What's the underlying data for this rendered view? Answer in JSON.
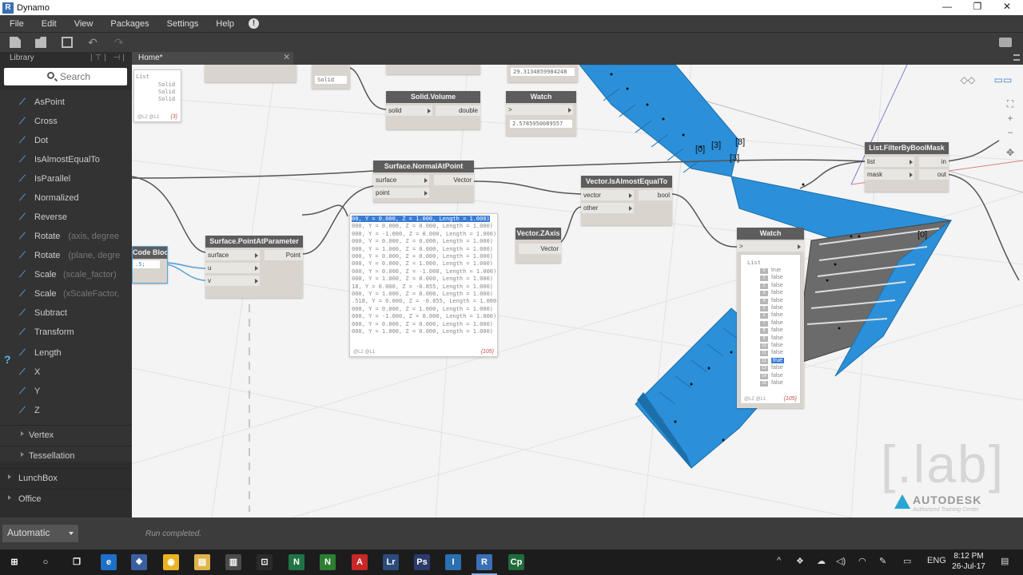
{
  "window": {
    "title": "Dynamo",
    "app_icon": "R",
    "minimize": "—",
    "maximize": "❐",
    "close": "✕"
  },
  "menu": {
    "items": [
      "File",
      "Edit",
      "View",
      "Packages",
      "Settings",
      "Help"
    ],
    "notice": "!"
  },
  "library": {
    "title": "Library",
    "search_placeholder": "Search",
    "items": [
      {
        "icon": "point-icon",
        "label": "AsPoint",
        "hint": ""
      },
      {
        "icon": "cross-icon",
        "label": "Cross",
        "hint": ""
      },
      {
        "icon": "dot-icon",
        "label": "Dot",
        "hint": ""
      },
      {
        "icon": "compare-icon",
        "label": "IsAlmostEqualTo",
        "hint": ""
      },
      {
        "icon": "parallel-icon",
        "label": "IsParallel",
        "hint": ""
      },
      {
        "icon": "normalize-icon",
        "label": "Normalized",
        "hint": ""
      },
      {
        "icon": "reverse-icon",
        "label": "Reverse",
        "hint": ""
      },
      {
        "icon": "rotate-icon",
        "label": "Rotate",
        "hint": "(axis, degree"
      },
      {
        "icon": "rotate-icon",
        "label": "Rotate",
        "hint": "(plane, degre"
      },
      {
        "icon": "scale-icon",
        "label": "Scale",
        "hint": "(scale_factor)"
      },
      {
        "icon": "scale-icon",
        "label": "Scale",
        "hint": "(xScaleFactor,"
      },
      {
        "icon": "subtract-icon",
        "label": "Subtract",
        "hint": ""
      },
      {
        "icon": "transform-icon",
        "label": "Transform",
        "hint": ""
      },
      {
        "icon": "length-icon",
        "label": "Length",
        "hint": ""
      },
      {
        "icon": "x-icon",
        "label": "X",
        "hint": ""
      },
      {
        "icon": "y-icon",
        "label": "Y",
        "hint": ""
      },
      {
        "icon": "z-icon",
        "label": "Z",
        "hint": ""
      }
    ],
    "help": "?",
    "categories": [
      "Vertex",
      "Tessellation",
      "LunchBox",
      "Office"
    ]
  },
  "tab": {
    "label": "Home*",
    "close": "✕"
  },
  "run": {
    "mode": "Automatic",
    "status": "Run completed."
  },
  "nodes": {
    "solid_volume": {
      "title": "Solid.Volume",
      "in": "solid",
      "out": "double"
    },
    "watch_top": {
      "title": "Watch",
      "value": "2.5785950089557"
    },
    "normal_at_point": {
      "title": "Surface.NormalAtPoint",
      "in1": "surface",
      "in2": "point",
      "out": "Vector"
    },
    "is_almost_equal": {
      "title": "Vector.IsAlmostEqualTo",
      "in1": "vector",
      "in2": "other",
      "out": "bool"
    },
    "filter_by_bool": {
      "title": "List.FilterByBoolMask",
      "in1": "list",
      "in2": "mask",
      "out1": "in",
      "out2": "out"
    },
    "zaxis": {
      "title": "Vector.ZAxis",
      "out": "Vector"
    },
    "point_at_param": {
      "title": "Surface.PointAtParameter",
      "in1": "surface",
      "in2": "u",
      "in3": "v",
      "out": "Point"
    },
    "code_block": {
      "title": "Code Block",
      "value": ".5;"
    },
    "watch_list": {
      "title": "Watch",
      "list_label": "List",
      "foot": "@L2 @L1",
      "count": "{105}"
    },
    "top_value": "29.3134859984248",
    "top_solid": "Solid",
    "left_watch": {
      "list_label": "List",
      "items": [
        "Solid",
        "Solid",
        "Solid"
      ],
      "foot": "@L2 @L1",
      "count": "{3}"
    }
  },
  "watch_items": [
    {
      "i": "0",
      "v": "true"
    },
    {
      "i": "1",
      "v": "false"
    },
    {
      "i": "2",
      "v": "false"
    },
    {
      "i": "3",
      "v": "false"
    },
    {
      "i": "4",
      "v": "false"
    },
    {
      "i": "5",
      "v": "false"
    },
    {
      "i": "6",
      "v": "false"
    },
    {
      "i": "7",
      "v": "false"
    },
    {
      "i": "8",
      "v": "false"
    },
    {
      "i": "9",
      "v": "false"
    },
    {
      "i": "10",
      "v": "false"
    },
    {
      "i": "11",
      "v": "false"
    },
    {
      "i": "12",
      "v": "true"
    },
    {
      "i": "13",
      "v": "false"
    },
    {
      "i": "14",
      "v": "false"
    },
    {
      "i": "15",
      "v": "false"
    }
  ],
  "vector_bubble": {
    "lines": [
      "00, Y = 0.000, Z = 1.000, Length = 1.000)",
      "000, Y = 0.000, Z = 0.000, Length = 1.000)",
      "000, Y = -1.000, Z = 0.000, Length = 1.000)",
      "000, Y = 0.000, Z = 0.000, Length = 1.000)",
      "000, Y = 1.000, Z = 0.000, Length = 1.000)",
      "000, Y = 0.000, Z = 0.000, Length = 1.000)",
      "000, Y = 0.000, Z = 1.000, Length = 1.000)",
      "000, Y = 0.000, Z = -1.000, Length = 1.000)",
      "000, Y = 1.000, Z = 0.000, Length = 1.000)",
      "18, Y = 0.000, Z = -0.855, Length = 1.000)",
      "000, Y = 1.000, Z = 0.000, Length = 1.000)",
      ".518, Y = 0.000, Z = -0.855, Length = 1.000",
      "000, Y = 0.000, Z = 1.000, Length = 1.000)",
      "000, Y = -1.000, Z = 0.000, Length = 1.000)",
      "000, Y = 0.000, Z = 0.000, Length = 1.000)",
      "000, Y = 1.000, Z = 0.000, Length = 1.000)"
    ],
    "foot": "@L2 @L1",
    "count": "{105}"
  },
  "geometry_labels": [
    "[0]",
    "[3]",
    "[3]",
    "[3]",
    "[0]"
  ],
  "watermark": {
    "lab": "[.lab]",
    "brand": "AUTODESK",
    "sub": "Authorized Training Center"
  },
  "taskbar": {
    "apps": [
      "⊞",
      "○",
      "❐",
      "e",
      "❖",
      "◉",
      "▤",
      "▥",
      "⊡",
      "N",
      "N",
      "A",
      "Lr",
      "Ps",
      "I",
      "R",
      "Cp"
    ],
    "lang": "ENG",
    "time": "8:12 PM",
    "date": "26-Jul-17"
  },
  "colors": {
    "geometry": "#2b90d9",
    "selected": "#3a7bd5",
    "node_header": "#5d5d5d"
  }
}
